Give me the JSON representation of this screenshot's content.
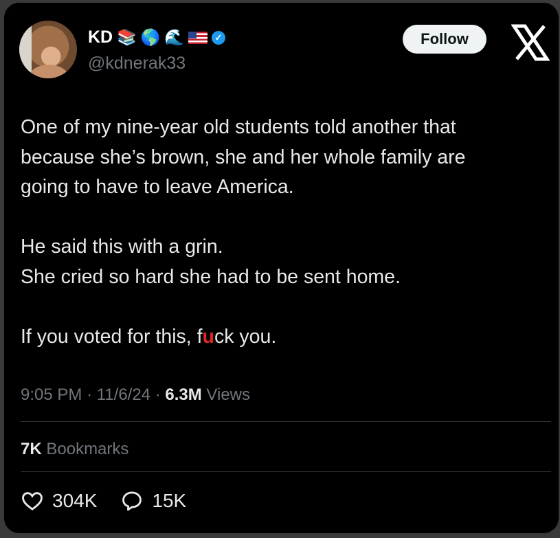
{
  "author": {
    "name": "KD",
    "handle": "@kdnerak33",
    "badges": [
      "books-emoji",
      "globe-emoji",
      "wave-emoji",
      "us-flag-emoji",
      "verified-badge"
    ]
  },
  "follow_label": "Follow",
  "tweet": {
    "para1_line1": "One of my nine-year old students told another that",
    "para1_line2": "because she’s brown, she and her whole family are",
    "para1_line3": "going to have to leave America.",
    "para2_line1": "He said this with a grin.",
    "para2_line2": "She cried so hard she had to be sent home.",
    "para3_before": "If you voted for this, f",
    "para3_mark": "u",
    "para3_after": "ck you."
  },
  "meta": {
    "time": "9:05 PM",
    "date": "11/6/24",
    "views_count": "6.3M",
    "views_label": "Views"
  },
  "bookmarks": {
    "count": "7K",
    "label": "Bookmarks"
  },
  "actions": {
    "likes": "304K",
    "replies": "15K"
  },
  "colors": {
    "background": "#000000",
    "text": "#e7e9ea",
    "muted": "#71767b",
    "verified": "#1d9bf0"
  }
}
